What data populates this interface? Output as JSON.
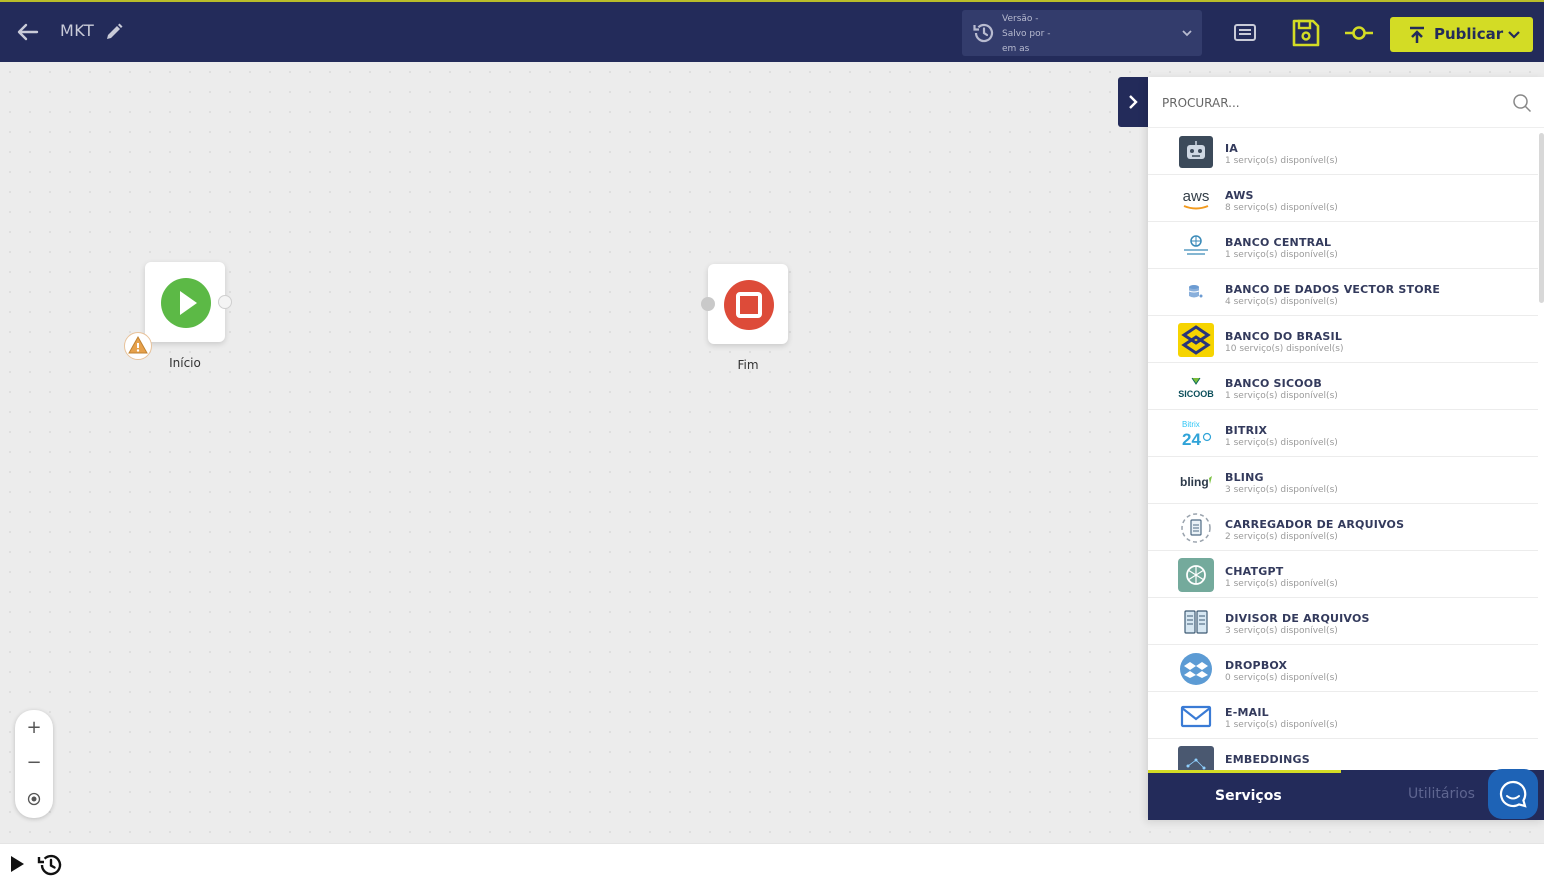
{
  "header": {
    "flow_title": "MKT",
    "version": {
      "line1": "Versão -",
      "line2": "Salvo por -",
      "line3": "em as"
    },
    "publish_label": "Publicar"
  },
  "canvas": {
    "nodes": {
      "start_label": "Início",
      "end_label": "Fim"
    },
    "zoom": {
      "zoom_in": "+",
      "zoom_out": "−"
    }
  },
  "panel": {
    "search_placeholder": "PROCURAR...",
    "services": [
      {
        "name": "IA",
        "count": "1 serviço(s) disponível(s)",
        "icon": "robot-icon"
      },
      {
        "name": "AWS",
        "count": "8 serviço(s) disponível(s)",
        "icon": "aws-logo"
      },
      {
        "name": "BANCO CENTRAL",
        "count": "1 serviço(s) disponível(s)",
        "icon": "banco-central-logo"
      },
      {
        "name": "BANCO DE DADOS VECTOR STORE",
        "count": "4 serviço(s) disponível(s)",
        "icon": "database-icon"
      },
      {
        "name": "BANCO DO BRASIL",
        "count": "10 serviço(s) disponível(s)",
        "icon": "banco-do-brasil-logo"
      },
      {
        "name": "BANCO SICOOB",
        "count": "1 serviço(s) disponível(s)",
        "icon": "sicoob-logo"
      },
      {
        "name": "BITRIX",
        "count": "1 serviço(s) disponível(s)",
        "icon": "bitrix24-logo"
      },
      {
        "name": "BLING",
        "count": "3 serviço(s) disponível(s)",
        "icon": "bling-logo"
      },
      {
        "name": "CARREGADOR DE ARQUIVOS",
        "count": "2 serviço(s) disponível(s)",
        "icon": "file-upload-icon"
      },
      {
        "name": "CHATGPT",
        "count": "1 serviço(s) disponível(s)",
        "icon": "chatgpt-logo"
      },
      {
        "name": "DIVISOR DE ARQUIVOS",
        "count": "3 serviço(s) disponível(s)",
        "icon": "file-split-icon"
      },
      {
        "name": "DROPBOX",
        "count": "0 serviço(s) disponível(s)",
        "icon": "dropbox-logo"
      },
      {
        "name": "E-MAIL",
        "count": "1 serviço(s) disponível(s)",
        "icon": "email-icon"
      },
      {
        "name": "EMBEDDINGS",
        "count": "",
        "icon": "embeddings-icon"
      }
    ],
    "logo_texts": {
      "aws": "aws",
      "sicoob": "SICOOB",
      "bitrix_small": "Bitrix",
      "bitrix_big": "24",
      "bling": "bling"
    },
    "tabs": {
      "services": "Serviços",
      "utilities": "Utilitários"
    }
  },
  "colors": {
    "navy": "#232b5a",
    "accent": "#d3dc25",
    "start_green": "#5cb946",
    "end_red": "#dd4b39"
  }
}
